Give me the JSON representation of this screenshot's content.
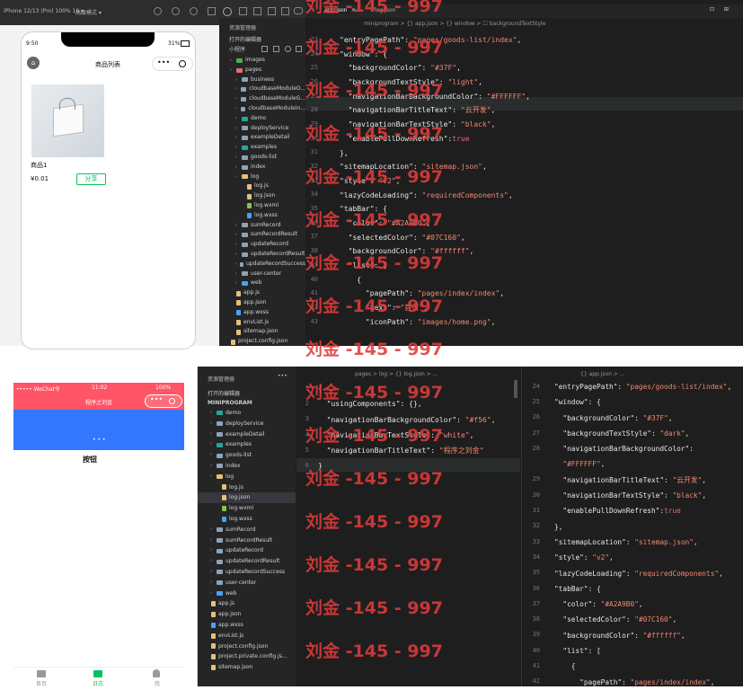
{
  "top": {
    "device": "iPhone 12/13 (Pro) 100% 16 ▾",
    "network": "高級模式 ▾",
    "explorer_title": "资源管理器",
    "open_editors": "打开的编辑器",
    "miniprogram": "小程序",
    "tabs": [
      "app.json",
      "log.json"
    ],
    "breadcrumb": "miniprogram > {} app.json > {} window > ☐ backgroundTextStyle",
    "phone": {
      "time": "9:50",
      "battery": "31%",
      "title": "商品列表",
      "product_name": "商品1",
      "price": "¥0.01",
      "share": "分享"
    },
    "tree": [
      {
        "label": "images",
        "indent": 1,
        "type": "folder",
        "color": "#4caf50"
      },
      {
        "label": "pages",
        "indent": 1,
        "type": "folder",
        "color": "#e06c75"
      },
      {
        "label": "business",
        "indent": 2,
        "type": "folder",
        "color": "#8fa3b7"
      },
      {
        "label": "cloudbaseModuleO...",
        "indent": 2,
        "type": "folder",
        "color": "#8fa3b7"
      },
      {
        "label": "cloudbaseModuleG...",
        "indent": 2,
        "type": "folder",
        "color": "#8fa3b7"
      },
      {
        "label": "cloudbaseModuleIn...",
        "indent": 2,
        "type": "folder",
        "color": "#8fa3b7"
      },
      {
        "label": "demo",
        "indent": 2,
        "type": "folder",
        "color": "#26a69a"
      },
      {
        "label": "deployService",
        "indent": 2,
        "type": "folder",
        "color": "#8fa3b7"
      },
      {
        "label": "exampleDetail",
        "indent": 2,
        "type": "folder",
        "color": "#8fa3b7"
      },
      {
        "label": "examples",
        "indent": 2,
        "type": "folder",
        "color": "#26a69a"
      },
      {
        "label": "goods-list",
        "indent": 2,
        "type": "folder",
        "color": "#8fa3b7"
      },
      {
        "label": "index",
        "indent": 2,
        "type": "folder",
        "color": "#8fa3b7"
      },
      {
        "label": "log",
        "indent": 2,
        "type": "folder",
        "color": "#e5c07b"
      },
      {
        "label": "log.js",
        "indent": 3,
        "type": "file",
        "color": "#e5c07b"
      },
      {
        "label": "log.json",
        "indent": 3,
        "type": "file",
        "color": "#e5c07b"
      },
      {
        "label": "log.wxml",
        "indent": 3,
        "type": "file",
        "color": "#8bc34a"
      },
      {
        "label": "log.wxss",
        "indent": 3,
        "type": "file",
        "color": "#42a5f5"
      },
      {
        "label": "sumRecord",
        "indent": 2,
        "type": "folder",
        "color": "#8fa3b7"
      },
      {
        "label": "sumRecordResult",
        "indent": 2,
        "type": "folder",
        "color": "#8fa3b7"
      },
      {
        "label": "updateRecord",
        "indent": 2,
        "type": "folder",
        "color": "#8fa3b7"
      },
      {
        "label": "updateRecordResult",
        "indent": 2,
        "type": "folder",
        "color": "#8fa3b7"
      },
      {
        "label": "updateRecordSuccess",
        "indent": 2,
        "type": "folder",
        "color": "#8fa3b7"
      },
      {
        "label": "user-center",
        "indent": 2,
        "type": "folder",
        "color": "#8fa3b7"
      },
      {
        "label": "web",
        "indent": 2,
        "type": "folder",
        "color": "#42a5f5"
      },
      {
        "label": "app.js",
        "indent": 1,
        "type": "file",
        "color": "#e5c07b"
      },
      {
        "label": "app.json",
        "indent": 1,
        "type": "file",
        "color": "#e5c07b"
      },
      {
        "label": "app.wxss",
        "indent": 1,
        "type": "file",
        "color": "#42a5f5"
      },
      {
        "label": "envList.js",
        "indent": 1,
        "type": "file",
        "color": "#e5c07b"
      },
      {
        "label": "sitemap.json",
        "indent": 1,
        "type": "file",
        "color": "#e5c07b"
      },
      {
        "label": "project.config.json",
        "indent": 0,
        "type": "file",
        "color": "#e5c07b"
      }
    ],
    "lines": [
      {
        "n": "23",
        "t": "\"entryPagePath\": \"pages/goods-list/index\","
      },
      {
        "n": "24",
        "t": "\"window\": {"
      },
      {
        "n": "25",
        "t": "  \"backgroundColor\": \"#37F\","
      },
      {
        "n": "26",
        "t": "  \"backgroundTextStyle\": \"light\","
      },
      {
        "n": "27",
        "t": "  \"navigationBarBackgroundColor\": \"#FFFFFF\","
      },
      {
        "n": "28",
        "t": "  \"navigationBarTitleText\": \"云开发\","
      },
      {
        "n": "29",
        "t": "  \"navigationBarTextStyle\": \"black\","
      },
      {
        "n": "30",
        "t": "  \"enablePullDownRefresh\":true"
      },
      {
        "n": "31",
        "t": "},"
      },
      {
        "n": "32",
        "t": "\"sitemapLocation\": \"sitemap.json\","
      },
      {
        "n": "33",
        "t": "\"style\": \"v2\","
      },
      {
        "n": "34",
        "t": "\"lazyCodeLoading\": \"requiredComponents\","
      },
      {
        "n": "35",
        "t": "\"tabBar\": {"
      },
      {
        "n": "36",
        "t": "  \"color\": \"#A2A9B0\","
      },
      {
        "n": "37",
        "t": "  \"selectedColor\": \"#07C160\","
      },
      {
        "n": "38",
        "t": "  \"backgroundColor\": \"#ffffff\","
      },
      {
        "n": "39",
        "t": "  \"list\": ["
      },
      {
        "n": "40",
        "t": "    {"
      },
      {
        "n": "41",
        "t": "      \"pagePath\": \"pages/index/index\","
      },
      {
        "n": "42",
        "t": "      \"text\": \"首页\","
      },
      {
        "n": "43",
        "t": "      \"iconPath\": \"images/home.png\","
      }
    ]
  },
  "bottom": {
    "phone": {
      "carrier": "••••• WeChat令",
      "time": "11:02",
      "battery": "100%",
      "title": "程序之刘金",
      "button": "按钮",
      "tabs": [
        "首页",
        "日志",
        "我"
      ]
    },
    "explorer_title": "资源管理器",
    "open_editors": "打开的编辑器",
    "miniprogram": "MINIPROGRAM",
    "tree": [
      {
        "label": "demo",
        "indent": 1,
        "type": "folder",
        "color": "#26a69a"
      },
      {
        "label": "deployService",
        "indent": 1,
        "type": "folder",
        "color": "#8fa3b7"
      },
      {
        "label": "exampleDetail",
        "indent": 1,
        "type": "folder",
        "color": "#8fa3b7"
      },
      {
        "label": "examples",
        "indent": 1,
        "type": "folder",
        "color": "#26a69a"
      },
      {
        "label": "goods-list",
        "indent": 1,
        "type": "folder",
        "color": "#8fa3b7"
      },
      {
        "label": "index",
        "indent": 1,
        "type": "folder",
        "color": "#8fa3b7"
      },
      {
        "label": "log",
        "indent": 1,
        "type": "folder",
        "color": "#e5c07b"
      },
      {
        "label": "log.js",
        "indent": 2,
        "type": "file",
        "color": "#e5c07b"
      },
      {
        "label": "log.json",
        "indent": 2,
        "type": "file",
        "color": "#e5c07b"
      },
      {
        "label": "log.wxml",
        "indent": 2,
        "type": "file",
        "color": "#8bc34a"
      },
      {
        "label": "log.wxss",
        "indent": 2,
        "type": "file",
        "color": "#42a5f5"
      },
      {
        "label": "sumRecord",
        "indent": 1,
        "type": "folder",
        "color": "#8fa3b7"
      },
      {
        "label": "sumRecordResult",
        "indent": 1,
        "type": "folder",
        "color": "#8fa3b7"
      },
      {
        "label": "updateRecord",
        "indent": 1,
        "type": "folder",
        "color": "#8fa3b7"
      },
      {
        "label": "updateRecordResult",
        "indent": 1,
        "type": "folder",
        "color": "#8fa3b7"
      },
      {
        "label": "updateRecordSuccess",
        "indent": 1,
        "type": "folder",
        "color": "#8fa3b7"
      },
      {
        "label": "user-center",
        "indent": 1,
        "type": "folder",
        "color": "#8fa3b7"
      },
      {
        "label": "web",
        "indent": 1,
        "type": "folder",
        "color": "#42a5f5"
      },
      {
        "label": "app.js",
        "indent": 0,
        "type": "file",
        "color": "#e5c07b"
      },
      {
        "label": "app.json",
        "indent": 0,
        "type": "file",
        "color": "#e5c07b"
      },
      {
        "label": "app.wxss",
        "indent": 0,
        "type": "file",
        "color": "#42a5f5"
      },
      {
        "label": "envList.js",
        "indent": 0,
        "type": "file",
        "color": "#e5c07b"
      },
      {
        "label": "project.config.json",
        "indent": 0,
        "type": "file",
        "color": "#e5c07b"
      },
      {
        "label": "project.private.config.js...",
        "indent": 0,
        "type": "file",
        "color": "#e5c07b"
      },
      {
        "label": "sitemap.json",
        "indent": 0,
        "type": "file",
        "color": "#e5c07b"
      }
    ],
    "left_breadcrumb": "pages > log > {} log.json > ...",
    "right_breadcrumb": "{} app.json > ...",
    "left_lines": [
      {
        "n": "1",
        "t": "{"
      },
      {
        "n": "2",
        "t": "  \"usingComponents\": {},"
      },
      {
        "n": "3",
        "t": "  \"navigationBarBackgroundColor\": \"#f56\","
      },
      {
        "n": "4",
        "t": "  \"navigationBarTextStyle\": \"white\","
      },
      {
        "n": "5",
        "t": "  \"navigationBarTitleText\": \"程序之刘金\""
      },
      {
        "n": "6",
        "t": "}"
      }
    ],
    "right_lines": [
      {
        "n": "24",
        "t": "\"entryPagePath\": \"pages/goods-list/index\","
      },
      {
        "n": "25",
        "t": "\"window\": {"
      },
      {
        "n": "26",
        "t": "  \"backgroundColor\": \"#37F\","
      },
      {
        "n": "27",
        "t": "  \"backgroundTextStyle\": \"dark\","
      },
      {
        "n": "28",
        "t": "  \"navigationBarBackgroundColor\":"
      },
      {
        "n": "",
        "t": "  \"#FFFFFF\","
      },
      {
        "n": "29",
        "t": "  \"navigationBarTitleText\": \"云开发\","
      },
      {
        "n": "30",
        "t": "  \"navigationBarTextStyle\": \"black\","
      },
      {
        "n": "31",
        "t": "  \"enablePullDownRefresh\":true"
      },
      {
        "n": "32",
        "t": "},"
      },
      {
        "n": "33",
        "t": "\"sitemapLocation\": \"sitemap.json\","
      },
      {
        "n": "34",
        "t": "\"style\": \"v2\","
      },
      {
        "n": "35",
        "t": "\"lazyCodeLoading\": \"requiredComponents\","
      },
      {
        "n": "36",
        "t": "\"tabBar\": {"
      },
      {
        "n": "37",
        "t": "  \"color\": \"#A2A9B0\","
      },
      {
        "n": "38",
        "t": "  \"selectedColor\": \"#07C160\","
      },
      {
        "n": "39",
        "t": "  \"backgroundColor\": \"#ffffff\","
      },
      {
        "n": "40",
        "t": "  \"list\": ["
      },
      {
        "n": "41",
        "t": "    {"
      },
      {
        "n": "42",
        "t": "      \"pagePath\": \"pages/index/index\","
      }
    ]
  },
  "watermark": "刘金 -145 - 997",
  "colors": {
    "editor_bg": "#1e1e1e",
    "sidebar_bg": "#252526",
    "nav_pink": "#f56",
    "blue": "#3377ff",
    "selected_green": "#07C160"
  }
}
